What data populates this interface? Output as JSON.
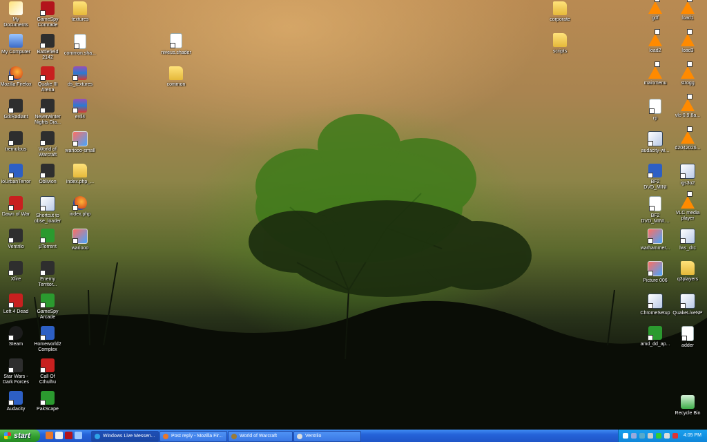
{
  "desktop": {
    "icons": [
      {
        "label": "My Documents",
        "glyph": "docs"
      },
      {
        "label": "My Computer",
        "glyph": "pc"
      },
      {
        "label": "Mozilla Firefox",
        "glyph": "fox"
      },
      {
        "label": "GtkRadiant",
        "glyph": "dark"
      },
      {
        "label": "tremulous",
        "glyph": "dark"
      },
      {
        "label": "ioUrbanTerror",
        "glyph": "blue"
      },
      {
        "label": "Dawn of War",
        "glyph": "red"
      },
      {
        "label": "Ventrilo",
        "glyph": "dark"
      },
      {
        "label": "Xfire",
        "glyph": "dark"
      },
      {
        "label": "Left 4 Dead",
        "glyph": "red"
      },
      {
        "label": "Steam",
        "glyph": "steam"
      },
      {
        "label": "Star Wars - Dark Forces",
        "glyph": "dark"
      },
      {
        "label": "Audacity",
        "glyph": "blue"
      },
      {
        "label": "GameSpy Comrade",
        "glyph": "star"
      },
      {
        "label": "Battlefield 2142",
        "glyph": "dark"
      },
      {
        "label": "Quake III Arena",
        "glyph": "red"
      },
      {
        "label": "Neverwinter Nights Dia...",
        "glyph": "dark"
      },
      {
        "label": "World of Warcraft",
        "glyph": "dark"
      },
      {
        "label": "Oblivion",
        "glyph": "dark"
      },
      {
        "label": "Shortcut to obse_loader",
        "glyph": "win"
      },
      {
        "label": "µTorrent",
        "glyph": "green"
      },
      {
        "label": "Enemy Territor...",
        "glyph": "dark"
      },
      {
        "label": "GameSpy Arcade",
        "glyph": "green"
      },
      {
        "label": "Homeworld2 Complex",
        "glyph": "blue"
      },
      {
        "label": "Call Of Cthulhu",
        "glyph": "red"
      },
      {
        "label": "PakScape",
        "glyph": "green"
      },
      {
        "label": "textures",
        "glyph": "folder"
      },
      {
        "label": "common.sha...",
        "glyph": "doc"
      },
      {
        "label": "ds_textures",
        "glyph": "rar"
      },
      {
        "label": "evil4",
        "glyph": "rar"
      },
      {
        "label": "wariooo-small",
        "glyph": "img"
      },
      {
        "label": "index.php_...",
        "glyph": "folder"
      },
      {
        "label": "index.php",
        "glyph": "fox"
      },
      {
        "label": "wariooo",
        "glyph": "img"
      },
      {
        "label": "niveus.shader",
        "glyph": "doc"
      },
      {
        "label": "common",
        "glyph": "folder"
      },
      {
        "label": "corporate",
        "glyph": "folder"
      },
      {
        "label": "scripts",
        "glyph": "folder"
      },
      {
        "label": "gdf",
        "glyph": "vlc"
      },
      {
        "label": "load2",
        "glyph": "vlc"
      },
      {
        "label": "mainmenu",
        "glyph": "vlc"
      },
      {
        "label": "rp",
        "glyph": "doc"
      },
      {
        "label": "audacity-wi...",
        "glyph": "win"
      },
      {
        "label": "BF2 DVD_MINI",
        "glyph": "blue"
      },
      {
        "label": "BF2 DVD_MINI....",
        "glyph": "doc"
      },
      {
        "label": "warhammer...",
        "glyph": "img"
      },
      {
        "label": "Picture 006",
        "glyph": "img"
      },
      {
        "label": "ChromeSetup",
        "glyph": "win"
      },
      {
        "label": "amd_dd_ap...",
        "glyph": "green"
      },
      {
        "label": "load1",
        "glyph": "vlc"
      },
      {
        "label": "load3",
        "glyph": "vlc"
      },
      {
        "label": "strogg",
        "glyph": "vlc"
      },
      {
        "label": "vlc-0.9.8a...",
        "glyph": "vlc"
      },
      {
        "label": "d2042026...",
        "glyph": "vlc"
      },
      {
        "label": "igs3o2",
        "glyph": "win"
      },
      {
        "label": "VLC media player",
        "glyph": "vlc"
      },
      {
        "label": "lws_drc",
        "glyph": "win"
      },
      {
        "label": "q3players",
        "glyph": "folder"
      },
      {
        "label": "QuakeLiveNP",
        "glyph": "win"
      },
      {
        "label": "adder",
        "glyph": "doc"
      },
      {
        "label": "Recycle Bin",
        "glyph": "bin"
      }
    ]
  },
  "taskbar": {
    "start_label": "start",
    "quicklaunch": [
      "firefox-icon",
      "ventrilo-icon",
      "gamespy-icon",
      "desktop-icon"
    ],
    "tasks": [
      {
        "label": "Windows Live Messen...",
        "active": true,
        "color": "#2fa3e8"
      },
      {
        "label": "Post reply - Mozilla Fir...",
        "active": false,
        "color": "#e8772a"
      },
      {
        "label": "World of Warcraft",
        "active": false,
        "color": "#9b7b35"
      },
      {
        "label": "Ventrilo",
        "active": false,
        "color": "#dddddd"
      }
    ],
    "clock": "4:05 PM"
  },
  "colors": {
    "taskbar": "#2563d9",
    "start": "#2f9b2c",
    "tray": "#0f86d9"
  }
}
